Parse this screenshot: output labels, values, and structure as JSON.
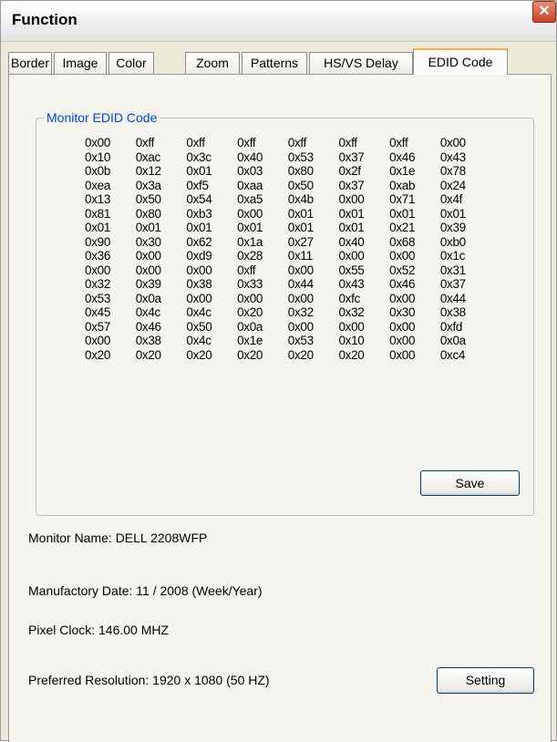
{
  "window": {
    "title": "Function",
    "close_glyph": "✕"
  },
  "tabs": [
    {
      "label": "Border"
    },
    {
      "label": "Image"
    },
    {
      "label": "Color"
    },
    {
      "label": "Zoom"
    },
    {
      "label": "Patterns"
    },
    {
      "label": "HS/VS Delay"
    },
    {
      "label": "EDID Code",
      "active": true
    }
  ],
  "edid": {
    "group_label": "Monitor EDID Code",
    "rows": [
      [
        "0x00",
        "0xff",
        "0xff",
        "0xff",
        "0xff",
        "0xff",
        "0xff",
        "0x00"
      ],
      [
        "0x10",
        "0xac",
        "0x3c",
        "0x40",
        "0x53",
        "0x37",
        "0x46",
        "0x43"
      ],
      [
        "0x0b",
        "0x12",
        "0x01",
        "0x03",
        "0x80",
        "0x2f",
        "0x1e",
        "0x78"
      ],
      [
        "0xea",
        "0x3a",
        "0xf5",
        "0xaa",
        "0x50",
        "0x37",
        "0xab",
        "0x24"
      ],
      [
        "0x13",
        "0x50",
        "0x54",
        "0xa5",
        "0x4b",
        "0x00",
        "0x71",
        "0x4f"
      ],
      [
        "0x81",
        "0x80",
        "0xb3",
        "0x00",
        "0x01",
        "0x01",
        "0x01",
        "0x01"
      ],
      [
        "0x01",
        "0x01",
        "0x01",
        "0x01",
        "0x01",
        "0x01",
        "0x21",
        "0x39"
      ],
      [
        "0x90",
        "0x30",
        "0x62",
        "0x1a",
        "0x27",
        "0x40",
        "0x68",
        "0xb0"
      ],
      [
        "0x36",
        "0x00",
        "0xd9",
        "0x28",
        "0x11",
        "0x00",
        "0x00",
        "0x1c"
      ],
      [
        "0x00",
        "0x00",
        "0x00",
        "0xff",
        "0x00",
        "0x55",
        "0x52",
        "0x31"
      ],
      [
        "0x32",
        "0x39",
        "0x38",
        "0x33",
        "0x44",
        "0x43",
        "0x46",
        "0x37"
      ],
      [
        "0x53",
        "0x0a",
        "0x00",
        "0x00",
        "0x00",
        "0xfc",
        "0x00",
        "0x44"
      ],
      [
        "0x45",
        "0x4c",
        "0x4c",
        "0x20",
        "0x32",
        "0x32",
        "0x30",
        "0x38"
      ],
      [
        "0x57",
        "0x46",
        "0x50",
        "0x0a",
        "0x00",
        "0x00",
        "0x00",
        "0xfd"
      ],
      [
        "0x00",
        "0x38",
        "0x4c",
        "0x1e",
        "0x53",
        "0x10",
        "0x00",
        "0x0a"
      ],
      [
        "0x20",
        "0x20",
        "0x20",
        "0x20",
        "0x20",
        "0x20",
        "0x00",
        "0xc4"
      ]
    ],
    "save_label": "Save"
  },
  "info": {
    "monitor_name": "Monitor Name: DELL 2208WFP",
    "manufactory_date": "Manufactory Date: 11 / 2008 (Week/Year)",
    "pixel_clock": "Pixel Clock: 146.00 MHZ",
    "preferred_resolution": "Preferred Resolution: 1920 x 1080 (50 HZ)",
    "setting_label": "Setting"
  },
  "colors": {
    "accent_tab": "#f4b33c",
    "group_label": "#0046d5",
    "close_button": "#d45a3c"
  }
}
